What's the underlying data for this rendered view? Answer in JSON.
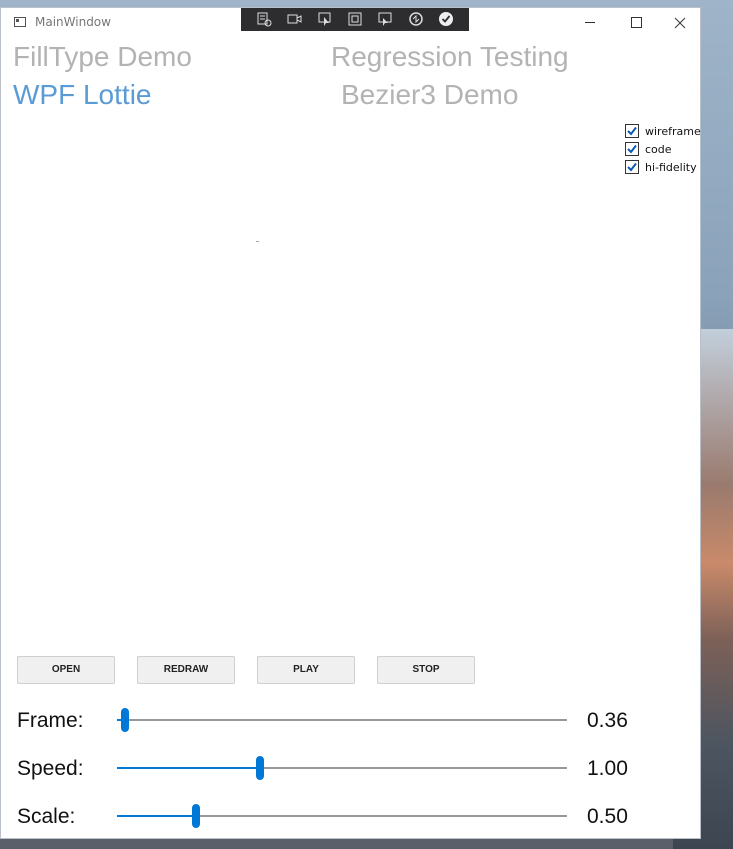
{
  "window": {
    "title": "MainWindow"
  },
  "links": {
    "filltype": "FillType Demo",
    "regression": "Regression Testing",
    "wpf_lottie": "WPF Lottie",
    "bezier3": "Bezier3 Demo"
  },
  "options": [
    {
      "label": "wireframe",
      "checked": true
    },
    {
      "label": "code",
      "checked": true
    },
    {
      "label": "hi-fidelity",
      "checked": true
    }
  ],
  "buttons": {
    "open": "OPEN",
    "redraw": "REDRAW",
    "play": "PLAY",
    "stop": "STOP"
  },
  "sliders": {
    "frame": {
      "label": "Frame:",
      "value": "0.36",
      "fraction": 0.01
    },
    "speed": {
      "label": "Speed:",
      "value": "1.00",
      "fraction": 0.315
    },
    "scale": {
      "label": "Scale:",
      "value": "0.50",
      "fraction": 0.17
    }
  },
  "colors": {
    "accent": "#0078d7",
    "active_link": "#5b9bd5",
    "inactive_link": "#b3b3b3"
  }
}
